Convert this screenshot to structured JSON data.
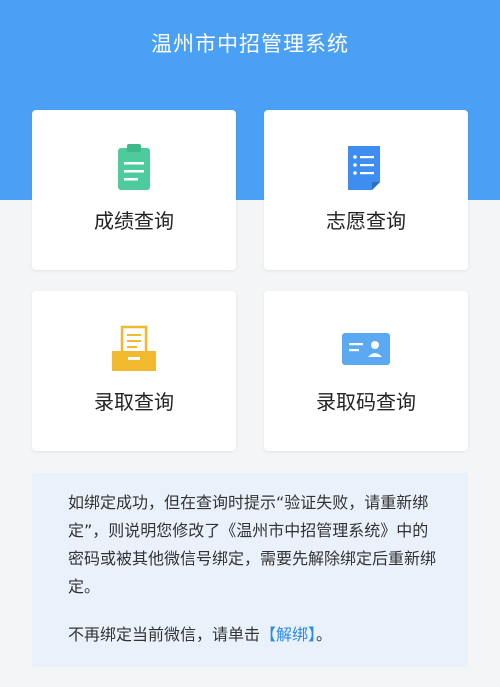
{
  "header": {
    "title": "温州市中招管理系统",
    "bg_color": "#4aa0f4"
  },
  "cards": [
    {
      "label": "成绩查询",
      "icon": "clipboard-icon",
      "icon_color": "#4ecb9c"
    },
    {
      "label": "志愿查询",
      "icon": "document-list-icon",
      "icon_color": "#3d8ef0"
    },
    {
      "label": "录取查询",
      "icon": "inbox-tray-icon",
      "icon_color": "#f2b82e"
    },
    {
      "label": "录取码查询",
      "icon": "id-card-icon",
      "icon_color": "#5aa9f2"
    }
  ],
  "notice": {
    "paragraph": "如绑定成功，但在查询时提示“验证失败，请重新绑定”，则说明您修改了《温州市中招管理系统》中的密码或被其他微信号绑定，需要先解除绑定后重新绑定。",
    "unbind_prefix": "不再绑定当前微信，请单击",
    "unbind_link": "【解绑】",
    "unbind_suffix": "。",
    "bg_color": "#e9f1fb",
    "link_color": "#2b8ae6"
  }
}
